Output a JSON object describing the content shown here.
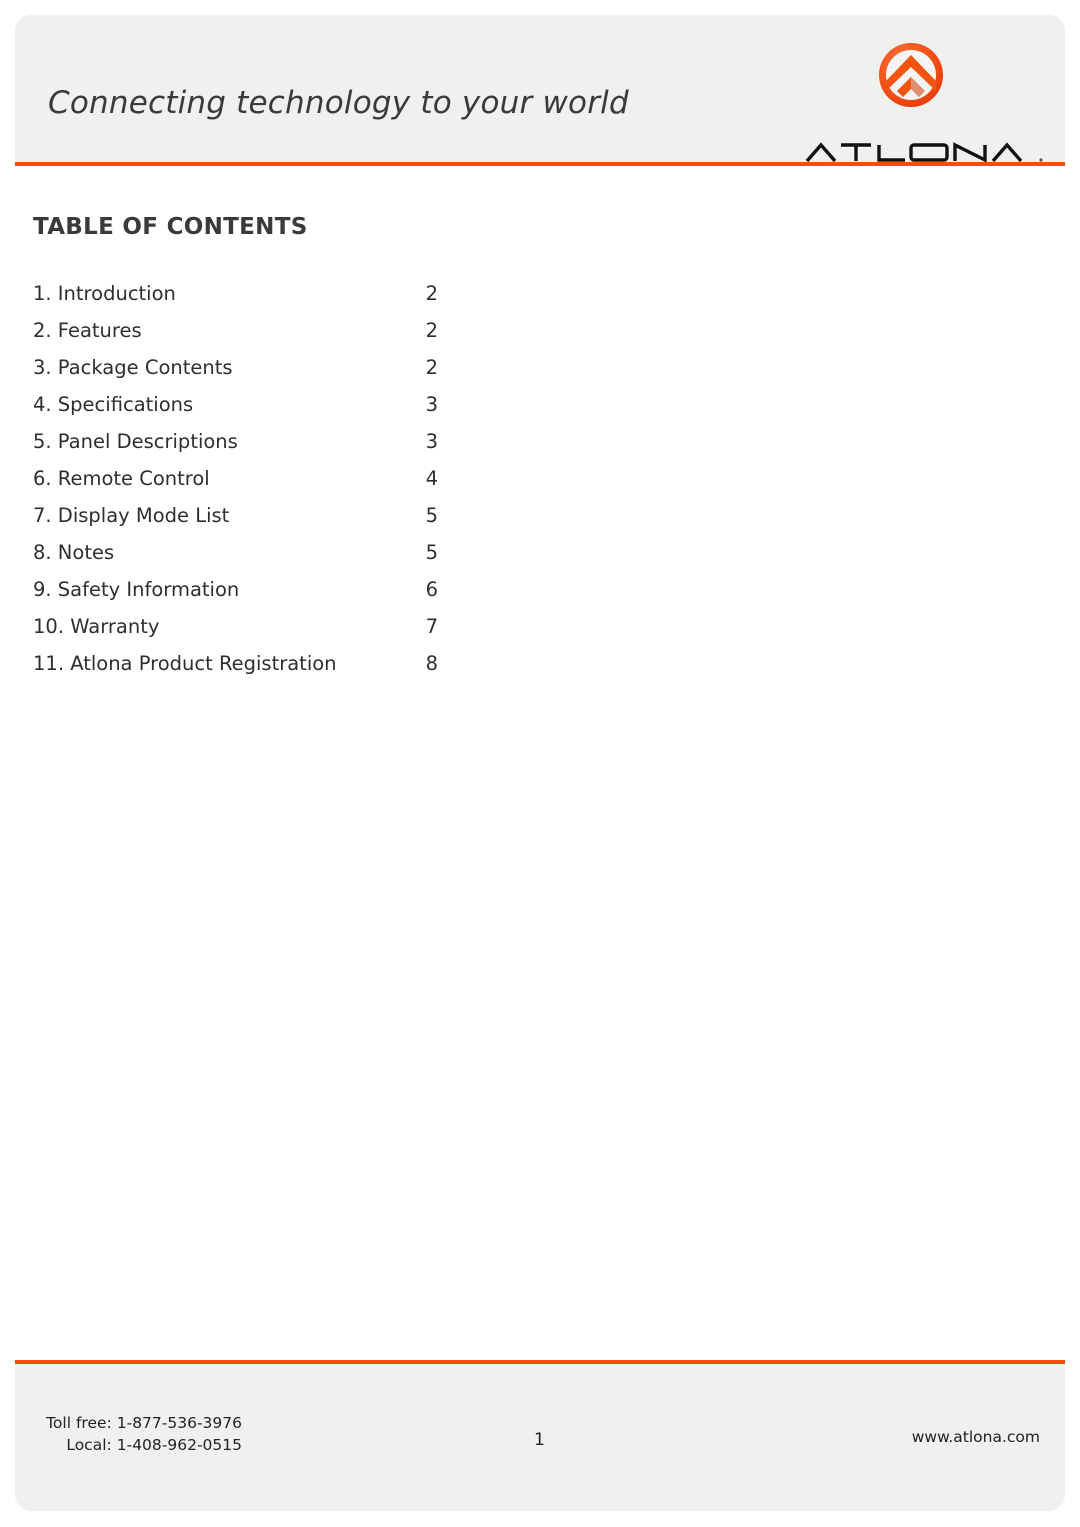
{
  "header": {
    "tagline": "Connecting technology to your world",
    "brand": "ATLONA",
    "logo_icon": "atlona-chevron-logo-icon",
    "accent_color": "#ff4a0a"
  },
  "toc": {
    "title": "TABLE OF CONTENTS",
    "entries": [
      {
        "label": "1. Introduction",
        "page": "2"
      },
      {
        "label": "2. Features",
        "page": "2"
      },
      {
        "label": "3. Package Contents",
        "page": "2"
      },
      {
        "label": "4. Specifications",
        "page": "3"
      },
      {
        "label": "5. Panel Descriptions",
        "page": "3"
      },
      {
        "label": "6. Remote Control",
        "page": "4"
      },
      {
        "label": "7. Display Mode List",
        "page": "5"
      },
      {
        "label": "8. Notes",
        "page": "5"
      },
      {
        "label": "9. Safety Information",
        "page": "6"
      },
      {
        "label": "10. Warranty",
        "page": "7"
      },
      {
        "label": "11. Atlona Product Registration",
        "page": "8"
      }
    ]
  },
  "footer": {
    "toll_free_label": "Toll free:",
    "toll_free_number": "1-877-536-3976",
    "local_label": "Local:",
    "local_number": "1-408-962-0515",
    "page_number": "1",
    "website": "www.atlona.com"
  }
}
